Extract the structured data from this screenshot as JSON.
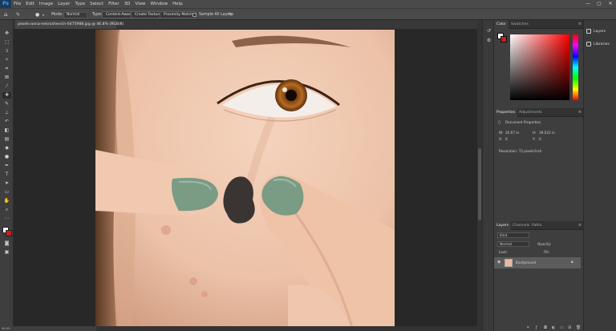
{
  "app": {
    "logo": "Ps"
  },
  "menu": [
    "File",
    "Edit",
    "Image",
    "Layer",
    "Type",
    "Select",
    "Filter",
    "3D",
    "View",
    "Window",
    "Help"
  ],
  "window_controls": [
    "—",
    "▢",
    "✕"
  ],
  "options": {
    "mode_label": "Mode:",
    "mode_value": "Normal",
    "type_label": "Type:",
    "type_buttons": [
      "Content-Aware",
      "Create Texture",
      "Proximity Match"
    ],
    "sample_all_layers": "Sample All Layers"
  },
  "document": {
    "tab_title": "pexels-anna-nekrashevich-6475988.jpg @ 46.8% (RGB/8)",
    "close": "×",
    "status": "46.8%"
  },
  "color_panel": {
    "tabs": [
      "Color",
      "Swatches"
    ],
    "foreground": "#ffffff",
    "background": "#d11a1a",
    "hue_color": "#ff0000"
  },
  "properties_panel": {
    "tabs": [
      "Properties",
      "Adjustments"
    ],
    "section": "Document Properties",
    "w_label": "W:",
    "w_value": "26.67 in",
    "h_label": "H:",
    "h_value": "39.022 in",
    "x_label": "X:",
    "x_value": "0",
    "y_label": "Y:",
    "y_value": "0",
    "resolution": "Resolution: 72 pixels/inch"
  },
  "layers_panel": {
    "tabs": [
      "Layers",
      "Channels",
      "Paths"
    ],
    "kind_placeholder": "Kind",
    "blend": "Normal",
    "opacity": "Opacity:",
    "lock": "Lock:",
    "fill": "Fill:",
    "layer_name": "Background"
  },
  "right_strip": {
    "items": [
      "Layers",
      "Libraries"
    ]
  },
  "photo": {
    "skin_light": "#efc8b1",
    "skin_shadow": "#d79e82",
    "iris": "#b86a22",
    "nail": "#7a9b84",
    "stamp": "#3a3532"
  }
}
